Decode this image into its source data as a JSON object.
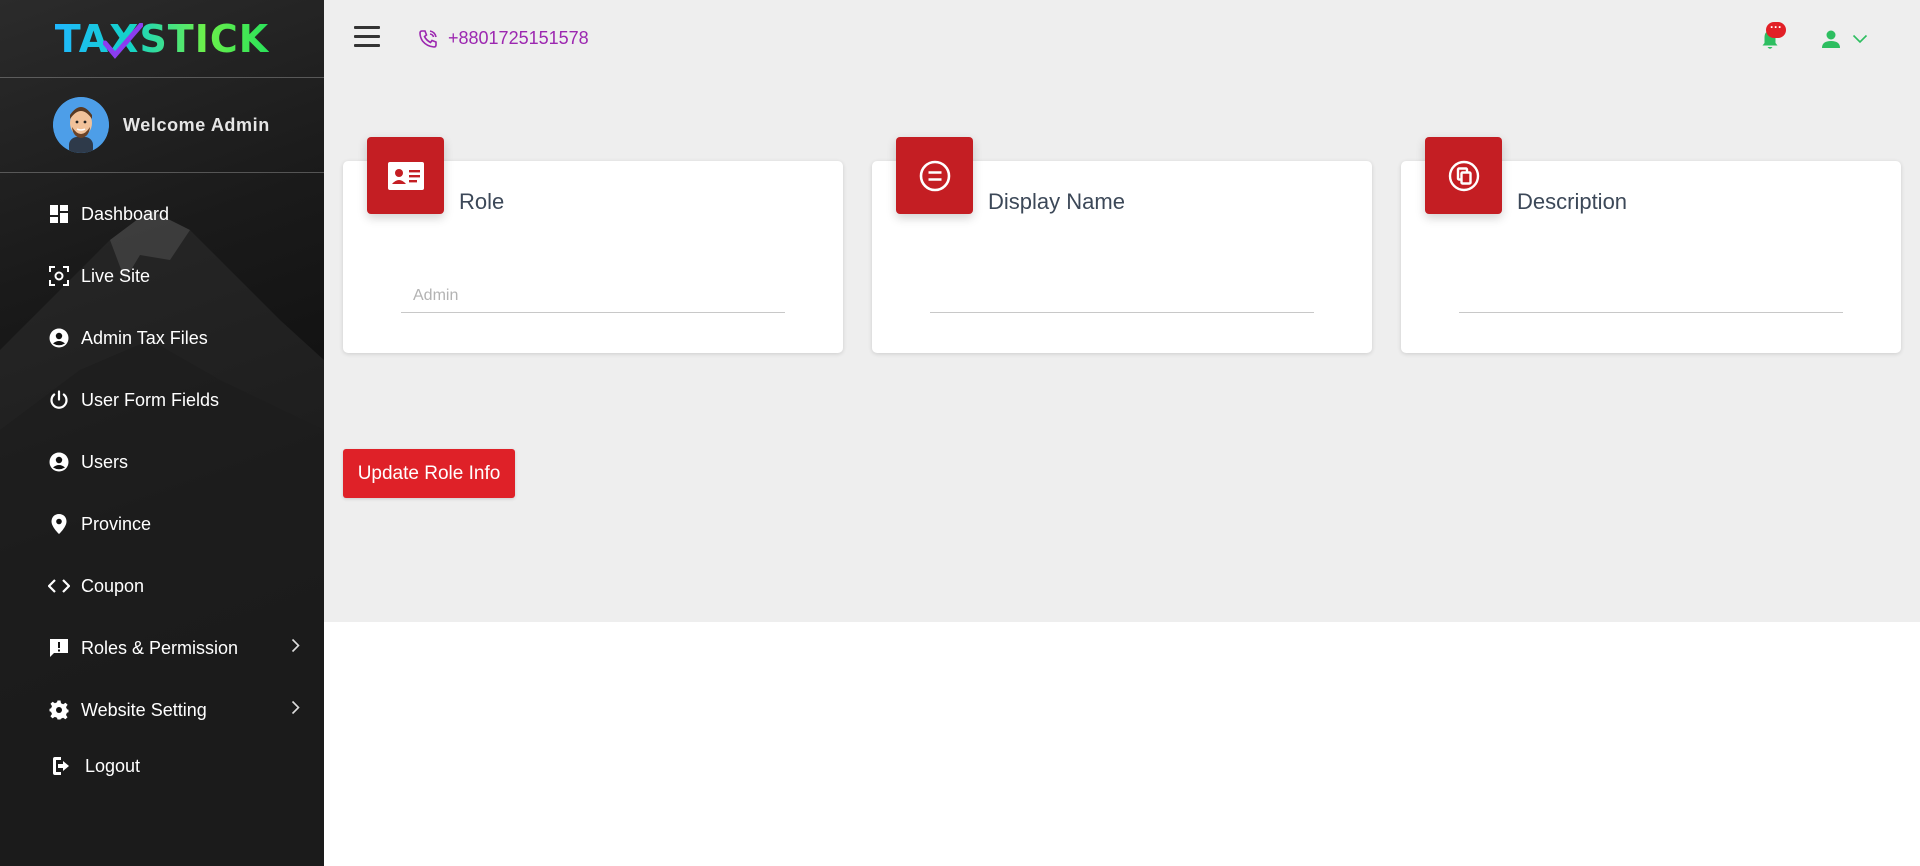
{
  "brand": {
    "name": "TAXSTICK",
    "gradient_start": "#1fb7ff",
    "gradient_end": "#2ae25a"
  },
  "user_panel": {
    "welcome_text": "Welcome Admin"
  },
  "sidebar": {
    "items": [
      {
        "label": "Dashboard",
        "icon": "dashboard-icon"
      },
      {
        "label": "Live Site",
        "icon": "live-site-icon"
      },
      {
        "label": "Admin Tax Files",
        "icon": "account-circle-icon"
      },
      {
        "label": "User Form Fields",
        "icon": "power-icon"
      },
      {
        "label": "Users",
        "icon": "account-circle-icon"
      },
      {
        "label": "Province",
        "icon": "location-pin-icon"
      },
      {
        "label": "Coupon",
        "icon": "code-icon"
      },
      {
        "label": "Roles & Permission",
        "icon": "feedback-icon",
        "has_submenu": true
      },
      {
        "label": "Website Setting",
        "icon": "gear-icon",
        "has_submenu": true
      },
      {
        "label": "Logout",
        "icon": "logout-icon"
      }
    ]
  },
  "topbar": {
    "phone": "+8801725151578",
    "notification_badge": "···",
    "phone_color": "#9c27b0",
    "accent_green": "#2dbe60"
  },
  "cards": [
    {
      "title": "Role",
      "icon": "contact-card-icon",
      "value": "",
      "placeholder": "Admin"
    },
    {
      "title": "Display Name",
      "icon": "equals-circle-icon",
      "value": "",
      "placeholder": ""
    },
    {
      "title": "Description",
      "icon": "copy-circle-icon",
      "value": "",
      "placeholder": ""
    }
  ],
  "actions": {
    "update_label": "Update Role Info",
    "primary_color": "#df2128",
    "card_icon_color": "#c41e23"
  }
}
